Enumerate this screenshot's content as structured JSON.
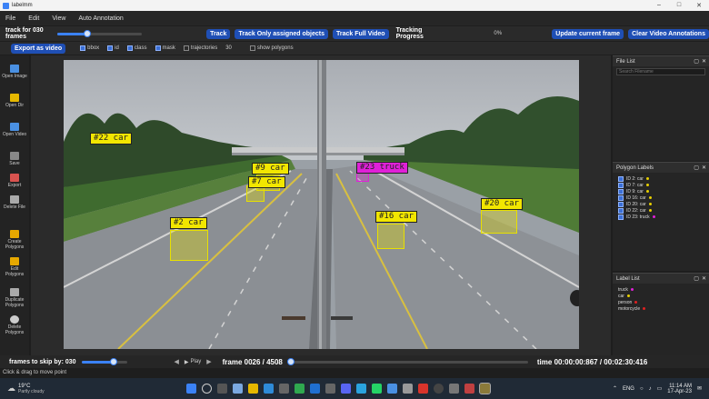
{
  "window": {
    "title": "labelmm"
  },
  "menu": [
    "File",
    "Edit",
    "View",
    "Auto Annotation"
  ],
  "toolbar": {
    "track_label": "track for 030 frames",
    "track_slider_fraction": 0.35,
    "btn_track": "Track",
    "btn_track_assigned": "Track Only assigned objects",
    "btn_track_full": "Track Full Video",
    "progress_label": "Tracking Progress",
    "progress_value": "0%",
    "btn_update_frame": "Update current frame",
    "btn_clear_annotations": "Clear Video Annotations"
  },
  "options": {
    "export_button": "Export as video",
    "checks": [
      {
        "label": "bbox",
        "checked": true
      },
      {
        "label": "id",
        "checked": true
      },
      {
        "label": "class",
        "checked": true
      },
      {
        "label": "mask",
        "checked": true
      },
      {
        "label": "trajectories",
        "checked": false
      }
    ],
    "traj_value": "30",
    "polygons": {
      "label": "show polygons",
      "checked": false
    }
  },
  "tools": [
    {
      "label": "Open Image",
      "icon": "open-image-icon",
      "color": "#4a90e2"
    },
    {
      "label": "Open Dir",
      "icon": "open-dir-icon",
      "color": "#e6b800"
    },
    {
      "label": "Open Video",
      "icon": "open-video-icon",
      "color": "#4a90e2"
    },
    {
      "label": "Save",
      "icon": "save-icon",
      "color": "#888888"
    },
    {
      "label": "Export",
      "icon": "export-icon",
      "color": "#d9534f"
    },
    {
      "label": "Delete File",
      "icon": "delete-file-icon",
      "color": "#aaaaaa"
    },
    {
      "label": "Create Polygons",
      "icon": "create-polygons-icon",
      "color": "#e6a800"
    },
    {
      "label": "Edit Polygons",
      "icon": "edit-polygons-icon",
      "color": "#e6a800"
    },
    {
      "label": "Duplicate Polygons",
      "icon": "duplicate-polygons-icon",
      "color": "#aaaaaa"
    },
    {
      "label": "Delete Polygons",
      "icon": "delete-polygons-icon",
      "color": "#cccccc"
    }
  ],
  "annotations": [
    {
      "label": "#22 car",
      "cls": "car"
    },
    {
      "label": "#9 car",
      "cls": "car"
    },
    {
      "label": "#7 car",
      "cls": "car"
    },
    {
      "label": "#23 truck",
      "cls": "truck"
    },
    {
      "label": "#2 car",
      "cls": "car"
    },
    {
      "label": "#16 car",
      "cls": "car"
    },
    {
      "label": "#20 car",
      "cls": "car"
    }
  ],
  "file_list": {
    "title": "File List",
    "search_placeholder": "Search Filename"
  },
  "polygon_labels": {
    "title": "Polygon Labels",
    "items": [
      {
        "text": "ID 2: car",
        "color": "#e8d000"
      },
      {
        "text": "ID 7: car",
        "color": "#e8d000"
      },
      {
        "text": "ID 9: car",
        "color": "#e8d000"
      },
      {
        "text": "ID 16: car",
        "color": "#e8d000"
      },
      {
        "text": "ID 20: car",
        "color": "#e8d000"
      },
      {
        "text": "ID 22: car",
        "color": "#e8d000"
      },
      {
        "text": "ID 23: truck",
        "color": "#e020d8"
      }
    ]
  },
  "label_list": {
    "title": "Label List",
    "items": [
      {
        "text": "truck",
        "color": "#e020d8"
      },
      {
        "text": "car",
        "color": "#e8d000"
      },
      {
        "text": "person",
        "color": "#e02020"
      },
      {
        "text": "motorcycle",
        "color": "#e02020"
      }
    ]
  },
  "bottom": {
    "skip_label": "frames to skip by: 030",
    "skip_slider_fraction": 0.7,
    "play_label": "Play",
    "frame_label": "frame 0026 / 4508",
    "frame_progress": 0.006,
    "time_label": "time 00:00:00:867 / 00:02:30:416"
  },
  "status": "Click & drag to move point",
  "taskbar": {
    "weather_temp": "19°C",
    "weather_desc": "Partly cloudy",
    "lang": "ENG",
    "time": "11:14 AM",
    "date": "17-Apr-23"
  }
}
